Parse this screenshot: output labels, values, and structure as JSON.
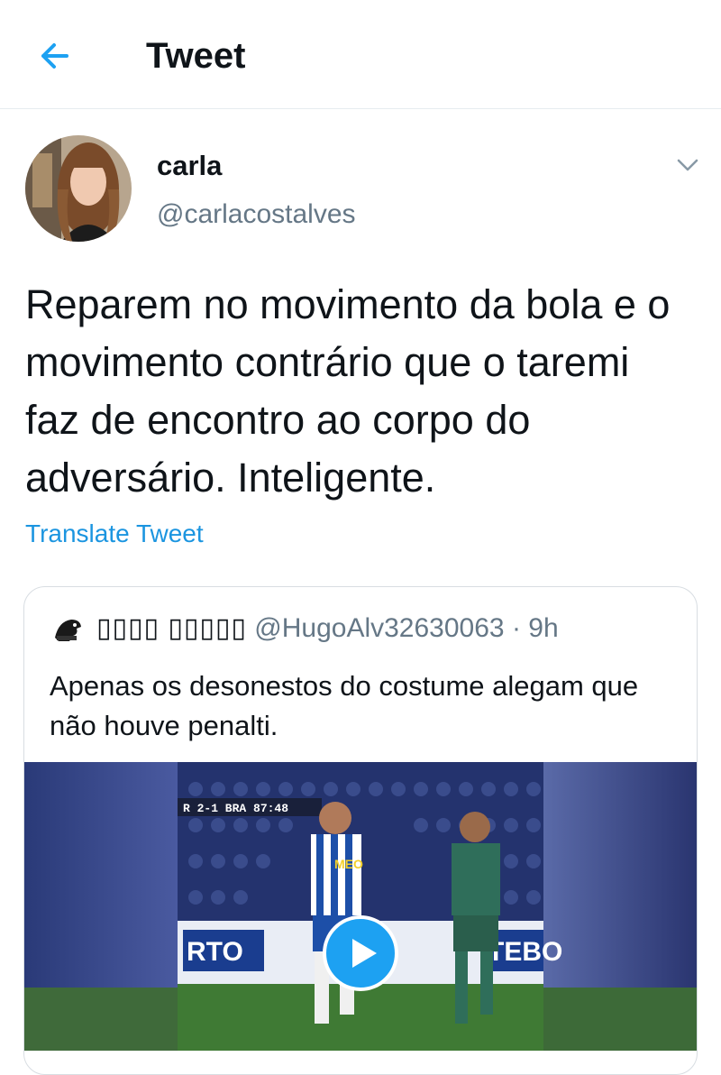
{
  "header": {
    "title": "Tweet",
    "back_icon": "arrow-left-icon"
  },
  "author": {
    "display_name": "carla",
    "handle": "@carlacostalves"
  },
  "tweet": {
    "text": "Reparem no movimento da bola e o movimento contrário que o taremi faz de encontro ao corpo do adversário. Inteligente.",
    "translate_label": "Translate Tweet"
  },
  "quoted_tweet": {
    "display_name": "▯▯▯▯ ▯▯▯▯▯",
    "handle": "@HugoAlv32630063",
    "separator": "·",
    "time": "9h",
    "text": "Apenas os desonestos do costume alegam que não houve penalti.",
    "media": {
      "scoreboard": "2-1  BRA  87:48",
      "shirt_text": "MEO",
      "board_left": "RTO",
      "board_right": "TEBO",
      "play_icon": "play-icon"
    }
  },
  "colors": {
    "link_blue": "#1b95e0",
    "secondary_text": "#657786",
    "border": "#e6ecf0"
  }
}
